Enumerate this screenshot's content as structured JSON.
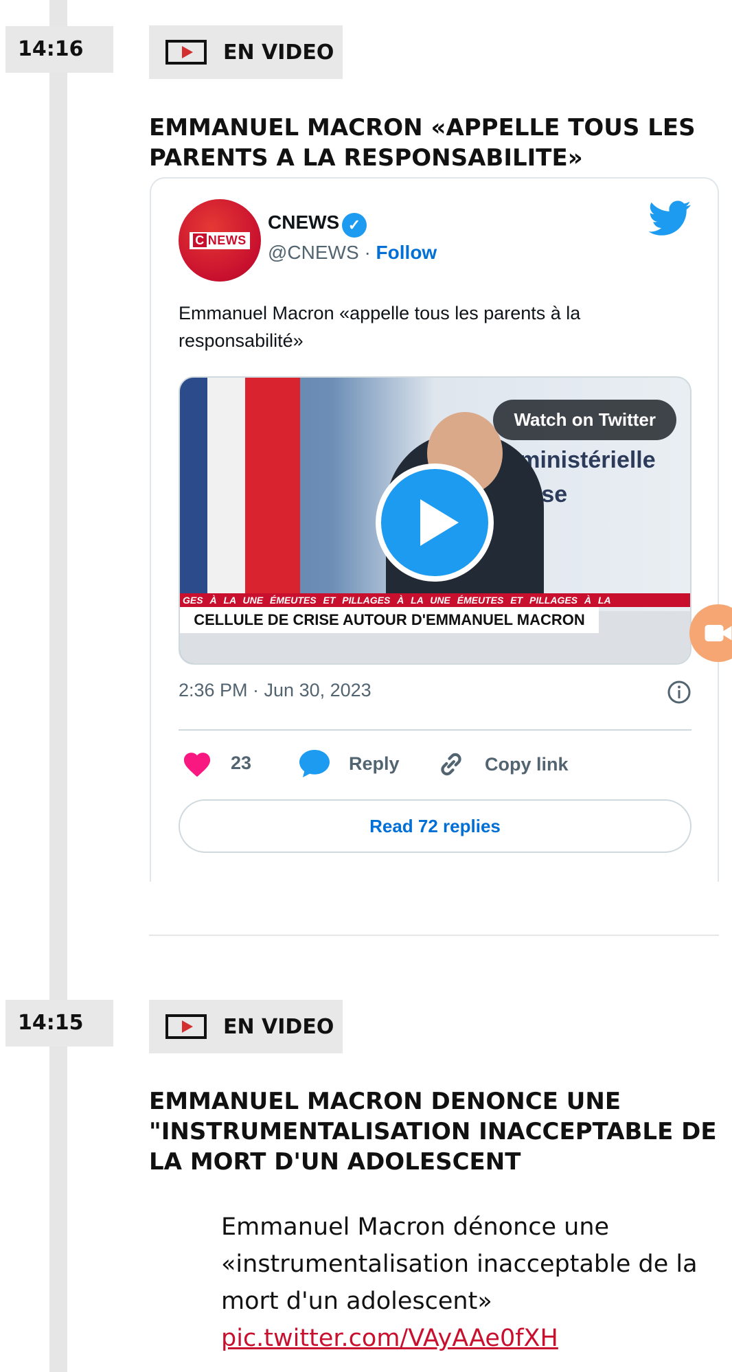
{
  "entries": [
    {
      "time": "14:16",
      "tag": "EN VIDEO",
      "headline": "EMMANUEL MACRON «APPELLE TOUS LES PARENTS A LA RESPONSABILITE»",
      "tweet": {
        "author_name": "CNEWS",
        "avatar_text": "NEWS",
        "avatar_letter": "C",
        "handle": "@CNEWS",
        "separator": "·",
        "follow_label": "Follow",
        "text": "Emmanuel Macron «appelle tous les parents à la responsabilité»",
        "watch_label": "Watch on Twitter",
        "ticker_text": "GES    À LA UNE    ÉMEUTES ET PILLAGES    À LA UNE    ÉMEUTES ET PILLAGES    À LA",
        "lower_third": "CELLULE DE CRISE AUTOUR D'EMMANUEL MACRON",
        "bg_text_line1": "nterministérielle",
        "bg_text_line2": "de Crise",
        "timestamp": "2:36 PM · Jun 30, 2023",
        "likes": "23",
        "reply_label": "Reply",
        "copy_link_label": "Copy link",
        "read_replies_label": "Read 72 replies"
      }
    },
    {
      "time": "14:15",
      "tag": "EN VIDEO",
      "headline": "EMMANUEL MACRON DENONCE UNE \"INSTRUMENTALISATION INACCEPTABLE DE LA MORT D'UN ADOLESCENT",
      "quote_text": "Emmanuel Macron dénonce une «instrumentalisation inacceptable de la mort d'un adolescent»",
      "quote_link": "pic.twitter.com/VAyAAe0fXH"
    }
  ],
  "colors": {
    "accent_red": "#c8102e",
    "twitter_blue": "#1d9bf0",
    "like_pink": "#f91880"
  }
}
